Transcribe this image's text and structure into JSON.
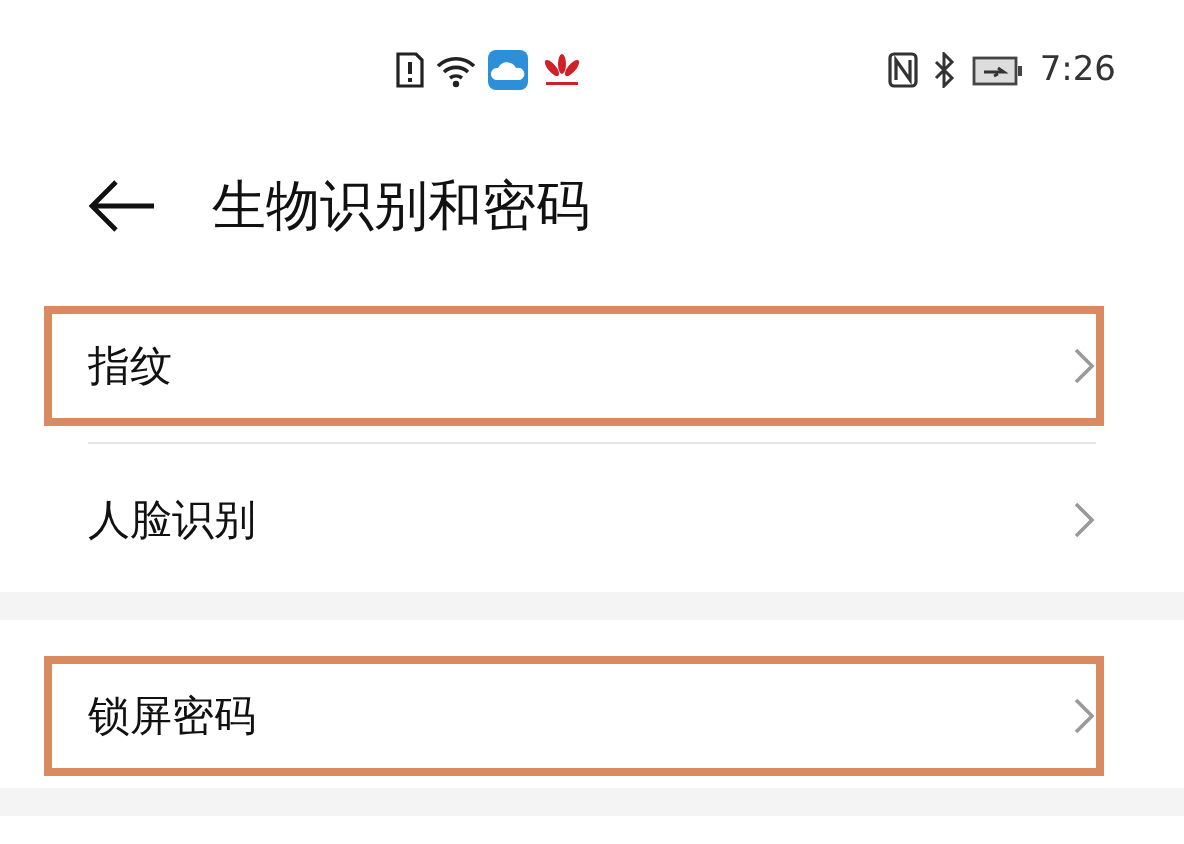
{
  "status_bar": {
    "time": "7:26"
  },
  "header": {
    "title": "生物识别和密码"
  },
  "groups": [
    {
      "items": [
        {
          "label": "指纹",
          "highlighted": true
        },
        {
          "label": "人脸识别",
          "highlighted": false
        }
      ]
    },
    {
      "items": [
        {
          "label": "锁屏密码",
          "highlighted": true
        }
      ]
    }
  ]
}
